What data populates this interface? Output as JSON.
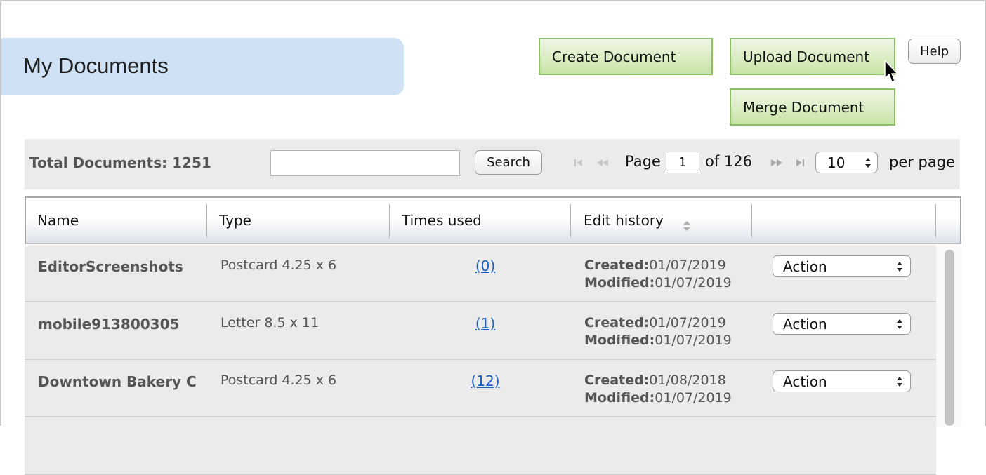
{
  "page": {
    "title": "My Documents"
  },
  "actions": {
    "create_label": "Create Document",
    "upload_label": "Upload Document",
    "merge_label": "Merge Document",
    "help_label": "Help"
  },
  "toolbar": {
    "total_label": "Total Documents: 1251",
    "search_value": "",
    "search_button_label": "Search",
    "page_label": "Page",
    "current_page": "1",
    "of_label": "of 126",
    "per_page_value": "10",
    "per_page_label": "per page",
    "pager_icons": [
      "first-page-icon",
      "previous-page-icon",
      "next-page-icon",
      "last-page-icon"
    ]
  },
  "table": {
    "columns": [
      "Name",
      "Type",
      "Times used",
      "Edit history",
      ""
    ],
    "sort_icon": "sort-icon",
    "created_label": "Created:",
    "modified_label": "Modified:",
    "action_label": "Action",
    "rows": [
      {
        "name": "EditorScreenshots",
        "type": "Postcard 4.25 x 6",
        "times_used": "(0)",
        "created": "01/07/2019",
        "modified": "01/07/2019"
      },
      {
        "name": "mobile913800305",
        "type": "Letter 8.5 x 11",
        "times_used": "(1)",
        "created": "01/07/2019",
        "modified": "01/07/2019"
      },
      {
        "name": "Downtown Bakery C",
        "type": "Postcard 4.25 x 6",
        "times_used": "(12)",
        "created": "01/08/2018",
        "modified": "01/07/2019"
      }
    ]
  },
  "colors": {
    "title_tab_bg": "#cfe1f5",
    "green_button_border": "#8cbf62",
    "link": "#1a5fc2",
    "row_bg": "#ebebeb"
  }
}
